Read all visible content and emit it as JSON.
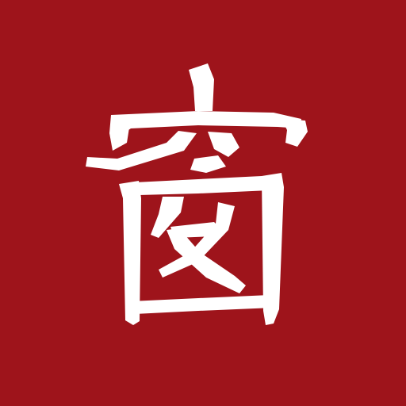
{
  "app_icon": {
    "character": "窗",
    "background_color": "#9e141b",
    "glyph_color": "#ffffff"
  }
}
